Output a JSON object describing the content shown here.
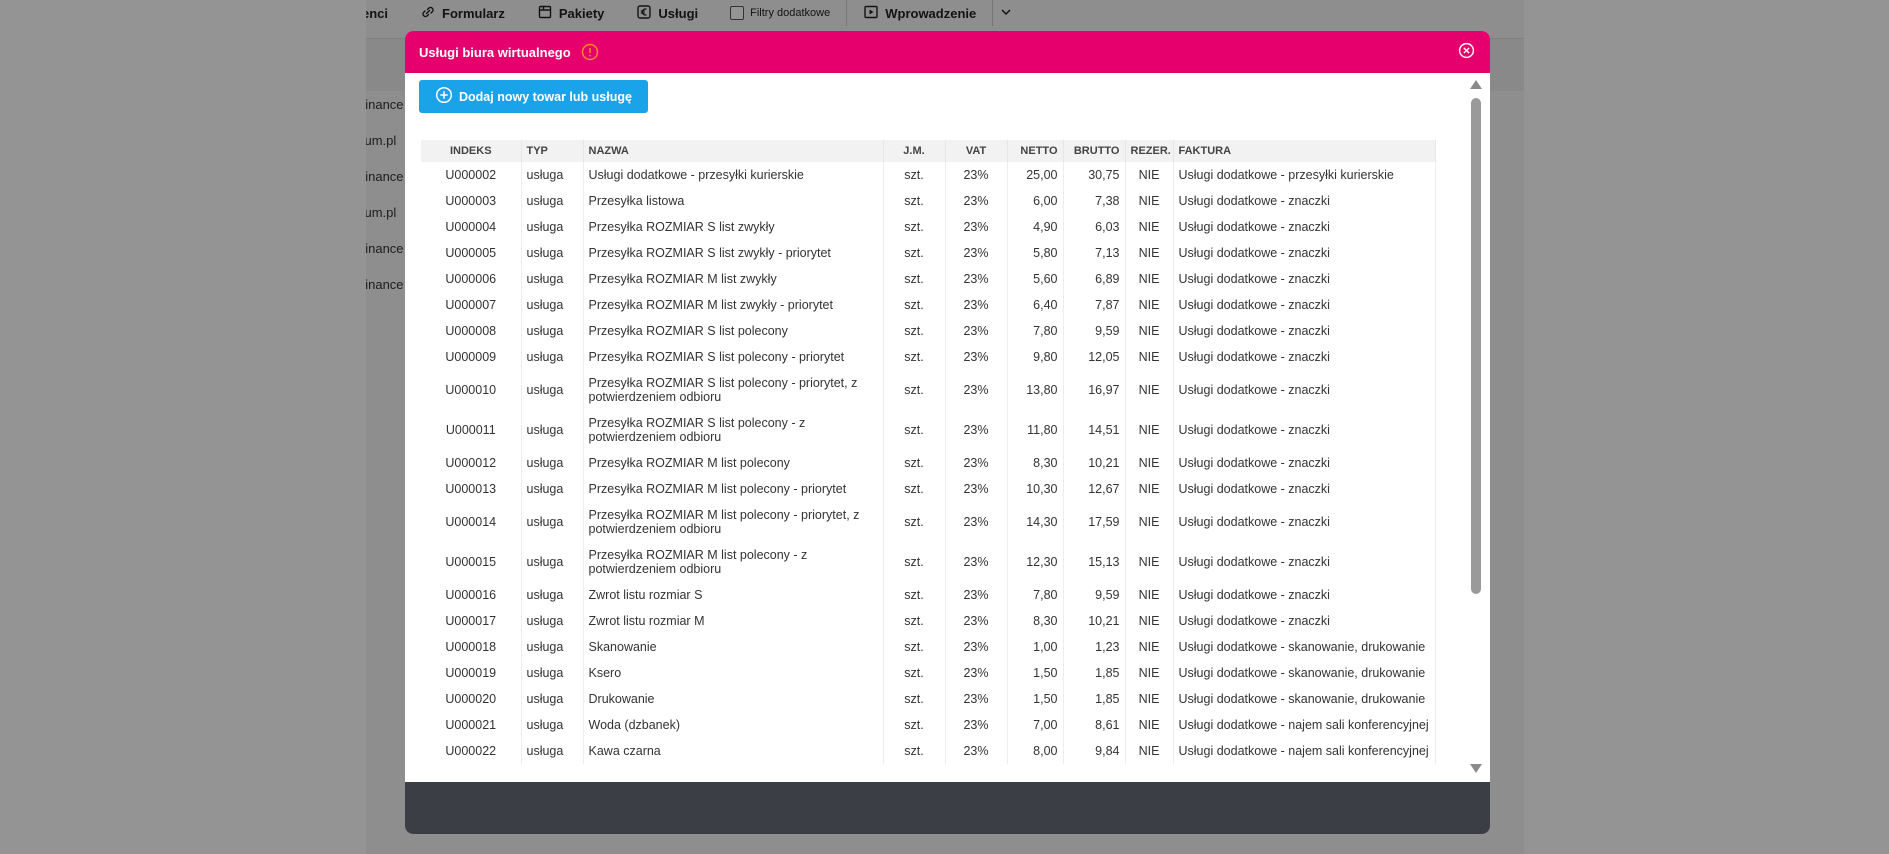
{
  "toolbar": {
    "items": [
      "enci",
      "Formularz",
      "Pakiety",
      "Usługi",
      "Filtry dodatkowe",
      "Wprowadzenie"
    ]
  },
  "side_items": [
    "tfinance",
    "itum.pl",
    "tfinance",
    "itum.pl",
    "tfinance",
    "tfinance"
  ],
  "modal": {
    "title": "Usługi biura wirtualnego",
    "add_button": "Dodaj nowy towar lub usługę",
    "columns": [
      "INDEKS",
      "TYP",
      "NAZWA",
      "J.M.",
      "VAT",
      "NETTO",
      "BRUTTO",
      "REZER.",
      "FAKTURA"
    ],
    "rows": [
      [
        "U000002",
        "usługa",
        "Usługi dodatkowe - przesyłki kurierskie",
        "szt.",
        "23%",
        "25,00",
        "30,75",
        "NIE",
        "Usługi dodatkowe - przesyłki kurierskie"
      ],
      [
        "U000003",
        "usługa",
        "Przesyłka listowa",
        "szt.",
        "23%",
        "6,00",
        "7,38",
        "NIE",
        "Usługi dodatkowe - znaczki"
      ],
      [
        "U000004",
        "usługa",
        "Przesyłka ROZMIAR S list zwykły",
        "szt.",
        "23%",
        "4,90",
        "6,03",
        "NIE",
        "Usługi dodatkowe - znaczki"
      ],
      [
        "U000005",
        "usługa",
        "Przesyłka ROZMIAR S list zwykły - priorytet",
        "szt.",
        "23%",
        "5,80",
        "7,13",
        "NIE",
        "Usługi dodatkowe - znaczki"
      ],
      [
        "U000006",
        "usługa",
        "Przesyłka ROZMIAR M list zwykły",
        "szt.",
        "23%",
        "5,60",
        "6,89",
        "NIE",
        "Usługi dodatkowe - znaczki"
      ],
      [
        "U000007",
        "usługa",
        "Przesyłka ROZMIAR M list zwykły - priorytet",
        "szt.",
        "23%",
        "6,40",
        "7,87",
        "NIE",
        "Usługi dodatkowe - znaczki"
      ],
      [
        "U000008",
        "usługa",
        "Przesyłka ROZMIAR S list polecony",
        "szt.",
        "23%",
        "7,80",
        "9,59",
        "NIE",
        "Usługi dodatkowe - znaczki"
      ],
      [
        "U000009",
        "usługa",
        "Przesyłka ROZMIAR S list polecony - priorytet",
        "szt.",
        "23%",
        "9,80",
        "12,05",
        "NIE",
        "Usługi dodatkowe - znaczki"
      ],
      [
        "U000010",
        "usługa",
        "Przesyłka ROZMIAR S list polecony - priorytet, z potwierdzeniem odbioru",
        "szt.",
        "23%",
        "13,80",
        "16,97",
        "NIE",
        "Usługi dodatkowe - znaczki"
      ],
      [
        "U000011",
        "usługa",
        "Przesyłka ROZMIAR S list polecony - z potwierdzeniem odbioru",
        "szt.",
        "23%",
        "11,80",
        "14,51",
        "NIE",
        "Usługi dodatkowe - znaczki"
      ],
      [
        "U000012",
        "usługa",
        "Przesyłka ROZMIAR M list polecony",
        "szt.",
        "23%",
        "8,30",
        "10,21",
        "NIE",
        "Usługi dodatkowe - znaczki"
      ],
      [
        "U000013",
        "usługa",
        "Przesyłka ROZMIAR M list polecony - priorytet",
        "szt.",
        "23%",
        "10,30",
        "12,67",
        "NIE",
        "Usługi dodatkowe - znaczki"
      ],
      [
        "U000014",
        "usługa",
        "Przesyłka ROZMIAR M list polecony - priorytet, z potwierdzeniem odbioru",
        "szt.",
        "23%",
        "14,30",
        "17,59",
        "NIE",
        "Usługi dodatkowe - znaczki"
      ],
      [
        "U000015",
        "usługa",
        "Przesyłka ROZMIAR M list polecony - z potwierdzeniem odbioru",
        "szt.",
        "23%",
        "12,30",
        "15,13",
        "NIE",
        "Usługi dodatkowe - znaczki"
      ],
      [
        "U000016",
        "usługa",
        "Zwrot listu rozmiar S",
        "szt.",
        "23%",
        "7,80",
        "9,59",
        "NIE",
        "Usługi dodatkowe - znaczki"
      ],
      [
        "U000017",
        "usługa",
        "Zwrot listu rozmiar M",
        "szt.",
        "23%",
        "8,30",
        "10,21",
        "NIE",
        "Usługi dodatkowe - znaczki"
      ],
      [
        "U000018",
        "usługa",
        "Skanowanie",
        "szt.",
        "23%",
        "1,00",
        "1,23",
        "NIE",
        "Usługi dodatkowe - skanowanie, drukowanie"
      ],
      [
        "U000019",
        "usługa",
        "Ksero",
        "szt.",
        "23%",
        "1,50",
        "1,85",
        "NIE",
        "Usługi dodatkowe - skanowanie, drukowanie"
      ],
      [
        "U000020",
        "usługa",
        "Drukowanie",
        "szt.",
        "23%",
        "1,50",
        "1,85",
        "NIE",
        "Usługi dodatkowe - skanowanie, drukowanie"
      ],
      [
        "U000021",
        "usługa",
        "Woda (dzbanek)",
        "szt.",
        "23%",
        "7,00",
        "8,61",
        "NIE",
        "Usługi dodatkowe - najem sali konferencyjnej"
      ],
      [
        "U000022",
        "usługa",
        "Kawa czarna",
        "szt.",
        "23%",
        "8,00",
        "9,84",
        "NIE",
        "Usługi dodatkowe - najem sali konferencyjnej"
      ]
    ]
  },
  "colors": {
    "header": "#e6006e",
    "button": "#1aa3e8",
    "footer": "#3b3f45"
  },
  "icons": {
    "toolbar": [
      "link-icon",
      "package-icon",
      "euro-icon",
      "checkbox-icon",
      "play-icon",
      "chevron-down-icon"
    ],
    "modal": [
      "info-icon",
      "close-icon",
      "plus-circle-icon"
    ]
  }
}
